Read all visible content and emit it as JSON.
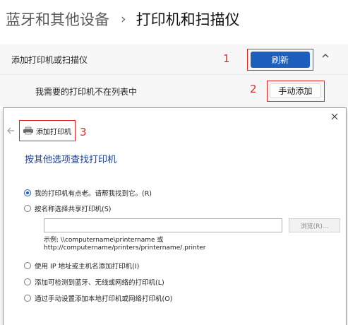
{
  "breadcrumb": {
    "parent": "蓝牙和其他设备",
    "separator": "›",
    "current": "打印机和扫描仪"
  },
  "settings": {
    "add_row_label": "添加打印机或扫描仪",
    "refresh_label": "刷新",
    "missing_label": "我需要的打印机不在列表中",
    "manual_add_label": "手动添加"
  },
  "annotations": {
    "n1": "1",
    "n2": "2",
    "n3": "3"
  },
  "dialog": {
    "title": "添加打印机",
    "heading": "按其他选项查找打印机",
    "options": [
      "我的打印机有点老。请帮我找到它。(R)",
      "按名称选择共享打印机(S)",
      "使用 IP 地址或主机名添加打印机(I)",
      "添加可检测到蓝牙、无线或网络的打印机(L)",
      "通过手动设置添加本地打印机或网络打印机(O)"
    ],
    "selected_option": 0,
    "share_input_value": "",
    "browse_label": "浏览(R)...",
    "example_line1": "示例: \\\\computername\\printername 或",
    "example_line2": "http://computername/printers/printername/.printer"
  },
  "colors": {
    "accent": "#1c5fbd",
    "annotation_red": "#e02424",
    "heading_blue": "#1b3f8f"
  },
  "icons": {
    "chevron": "chevron-up-icon",
    "close": "close-icon",
    "back": "back-arrow-icon",
    "printer": "printer-icon"
  }
}
